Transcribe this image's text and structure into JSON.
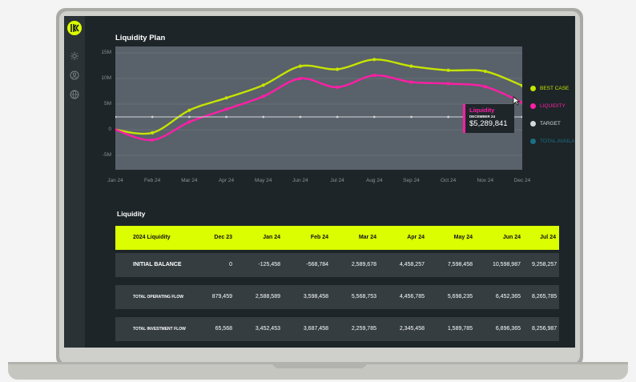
{
  "colors": {
    "accent": "#dbff00",
    "best_case": "#c6e400",
    "liquidity": "#ff1ea6",
    "target": "#d5d8db",
    "total_available": "#1b6f87",
    "screen_bg": "#1d2528",
    "plot_bg": "#59616a"
  },
  "sidebar": {
    "icons": [
      "logo-icon",
      "settings-icon",
      "user-icon",
      "globe-icon"
    ]
  },
  "chart": {
    "title": "Liquidity Plan",
    "tooltip": {
      "label": "Liquidity",
      "date": "DECEMBER 24",
      "value": "$5,289,841"
    }
  },
  "chart_data": {
    "type": "line",
    "title": "Liquidity Plan",
    "x_ticks": [
      "Jan 24",
      "Feb 24",
      "Mar 24",
      "Apr 24",
      "May 24",
      "Jun 24",
      "Jul 24",
      "Aug 24",
      "Sep 24",
      "Oct 24",
      "Nov 24",
      "Dec 24"
    ],
    "y_ticks": [
      "15M",
      "10M",
      "5M",
      "0",
      "-5M"
    ],
    "ylim": [
      -5,
      15
    ],
    "grid": true,
    "legend_position": "right",
    "series": [
      {
        "name": "BEST CASE",
        "color": "#c6e400",
        "values": [
          0,
          -0.6,
          3.8,
          6.2,
          8.7,
          12.4,
          11.8,
          13.7,
          12.4,
          11.6,
          11.4,
          8.6
        ]
      },
      {
        "name": "LIQUIDITY",
        "color": "#ff1ea6",
        "values": [
          0,
          -2,
          1.5,
          4,
          6.5,
          10,
          8.3,
          10.6,
          9.3,
          9.0,
          8.4,
          5.3
        ]
      },
      {
        "name": "TARGET",
        "color": "#d5d8db",
        "values": [
          2.5,
          2.5,
          2.5,
          2.5,
          2.5,
          2.5,
          2.5,
          2.5,
          2.5,
          2.5,
          2.5,
          2.5
        ]
      }
    ],
    "legend_extra": [
      {
        "name": "TOTAL AVAILABLE",
        "color": "#1b6f87"
      }
    ]
  },
  "legend": [
    {
      "label": "BEST CASE",
      "color": "#c6e400"
    },
    {
      "label": "LIQUIDITY",
      "color": "#ff1ea6"
    },
    {
      "label": "TARGET",
      "color": "#d5d8db"
    },
    {
      "label": "TOTAL AVAILABLE",
      "color": "#1b6f87"
    }
  ],
  "table": {
    "title": "Liquidity",
    "headers": [
      "2024 Liquidity",
      "Dec 23",
      "Jan 24",
      "Feb 24",
      "Mar 24",
      "Apr 24",
      "May 24",
      "Jun 24",
      "Jul 24"
    ],
    "rows": [
      {
        "label": "INITIAL BALANCE",
        "values": [
          "0",
          "-125,458",
          "-568,784",
          "2,589,678",
          "4,458,257",
          "7,598,458",
          "10,598,987",
          "9,258,257"
        ]
      },
      {
        "label": "TOTAL OPERATING FLOW",
        "values": [
          "879,459",
          "2,588,589",
          "3,598,458",
          "5,568,753",
          "4,456,785",
          "5,698,235",
          "6,452,365",
          "8,265,785"
        ]
      },
      {
        "label": "TOTAL INVESTMENT FLOW",
        "values": [
          "65,568",
          "3,452,453",
          "3,687,458",
          "2,259,785",
          "2,345,458",
          "1,589,785",
          "6,896,365",
          "8,256,987"
        ]
      }
    ]
  }
}
